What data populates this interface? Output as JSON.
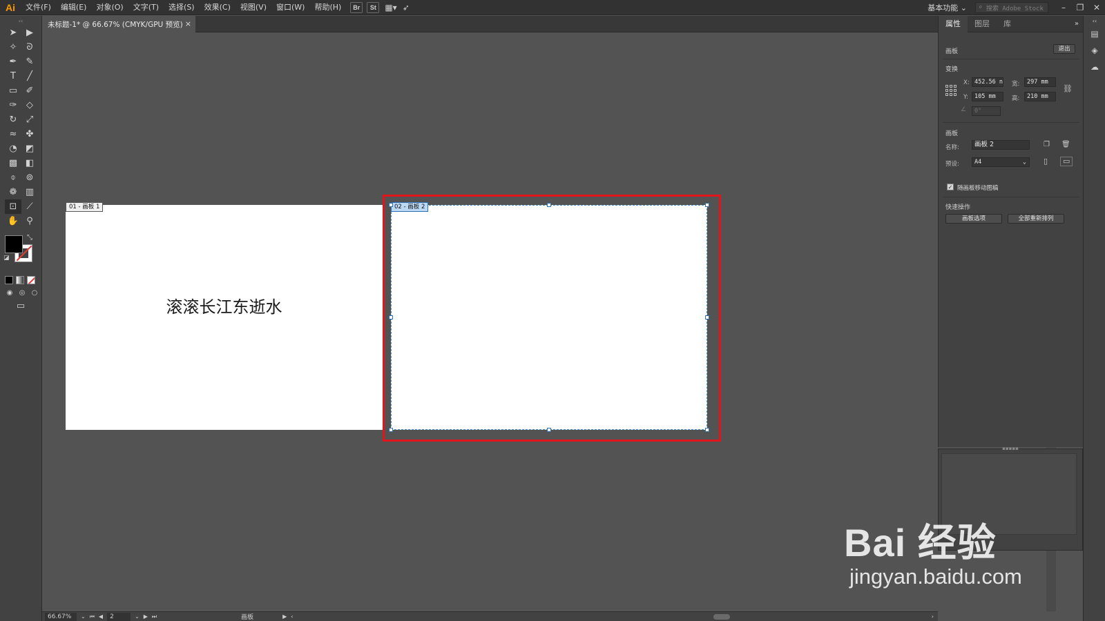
{
  "menubar": {
    "logo": "Ai",
    "items": [
      "文件(F)",
      "编辑(E)",
      "对象(O)",
      "文字(T)",
      "选择(S)",
      "效果(C)",
      "视图(V)",
      "窗口(W)",
      "帮助(H)"
    ],
    "bridge": "Br",
    "stock": "St",
    "workspace": "基本功能",
    "search_placeholder": "搜索 Adobe Stock"
  },
  "document_tab": {
    "title": "未标题-1* @ 66.67% (CMYK/GPU 预览)",
    "close": "×"
  },
  "canvas": {
    "artboard1": {
      "label": "01 - 画板 1",
      "text": "滚滚长江东逝水"
    },
    "artboard2": {
      "label": "02 - 画板 2"
    }
  },
  "statusbar": {
    "zoom": "66.67%",
    "page": "2",
    "tool": "画板"
  },
  "panel": {
    "tabs": [
      "属性",
      "图层",
      "库"
    ],
    "header": "画板",
    "exit_button": "退出",
    "transform_title": "变换",
    "x_label": "X:",
    "x_value": "452.56 n",
    "y_label": "Y:",
    "y_value": "105 mm",
    "w_label": "宽:",
    "w_value": "297 mm",
    "h_label": "高:",
    "h_value": "210 mm",
    "angle_value": "0°",
    "artboard_title": "画板",
    "name_label": "名称:",
    "name_value": "画板 2",
    "preset_label": "预设:",
    "preset_value": "A4",
    "move_with_artboard": "随画板移动图稿",
    "quick_actions_title": "快速操作",
    "artboard_options_button": "画板选项",
    "rearrange_all_button": "全部重新排列"
  },
  "watermark": {
    "logo": "Bai 经验",
    "url": "jingyan.baidu.com"
  }
}
